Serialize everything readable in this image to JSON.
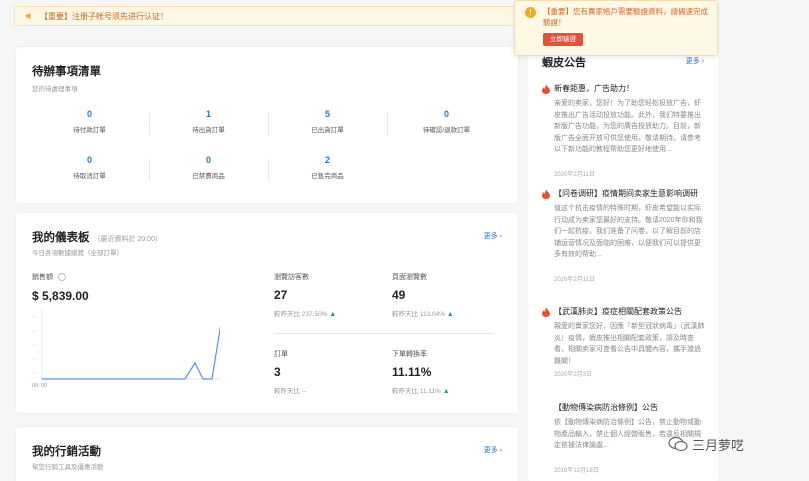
{
  "notice": {
    "text": "【重要】注册子帐号须先进行认证！"
  },
  "todo": {
    "title": "待辦事項清單",
    "subtitle": "您的待處理事項",
    "items": [
      {
        "value": "0",
        "label": "待付款訂單"
      },
      {
        "value": "1",
        "label": "待出貨訂單"
      },
      {
        "value": "5",
        "label": "已出貨訂單"
      },
      {
        "value": "0",
        "label": "待確認/退款訂單"
      },
      {
        "value": "0",
        "label": "待取消訂單"
      },
      {
        "value": "0",
        "label": "已禁賣商品"
      },
      {
        "value": "2",
        "label": "已售完商品"
      }
    ]
  },
  "dashboard": {
    "title": "我的儀表板",
    "note": "（最近資料於 20:00）",
    "subtitle": "今日各項數據總覽（全部訂單）",
    "more": "更多",
    "sales_label": "銷售額",
    "sales_value": "$ 5,839.00",
    "axis_label": "00: 00",
    "kpis": [
      {
        "label": "瀏覽訪客數",
        "value": "27",
        "compare": "較昨天比 237.50%"
      },
      {
        "label": "頁面瀏覽數",
        "value": "49",
        "compare": "較昨天比 113.04%"
      },
      {
        "label": "訂單",
        "value": "3",
        "compare": "較昨天比 --"
      },
      {
        "label": "下單轉換率",
        "value": "11.11%",
        "compare": "較昨天比 11.11%"
      }
    ]
  },
  "marketing": {
    "title": "我的行銷活動",
    "subtitle": "幫您行銷工具及優惠活動",
    "more": "更多"
  },
  "announcements": {
    "title": "蝦皮公告",
    "more": "更多",
    "items": [
      {
        "title": "新春鉅惠，广告助力！",
        "body": "亲爱的卖家，您好！为了助您轻松投放广告，虾皮推出广告活动投放功能。此外，我们特要推出新版广告功能，为您的廣告投放助力。目前，新版广告全面开放可供您使用，敬请期待。请参考以下新功能的教程帮助您更好地使用...",
        "date": "2020年2月11日"
      },
      {
        "title": "【问卷调研】疫情期间卖家生意影响调研",
        "body": "值这个抗击疫情的特殊时期，虾皮希望能以实际行动成为卖家您最好的支持。敬请2020年你和我们一起抗疫。我们准备了问卷，以了解目前的店铺运营情况及面临的困难，以便我们可以提供更多有效的帮助...",
        "date": "2020年2月11日"
      },
      {
        "title": "【武漢肺炎】疫症相關配套政策公告",
        "body": "親愛的賣家您好，因應「新型冠狀病毒」（武漢肺炎）疫情，蝦皮推出相關配套政策，請及時查看，相關卖家可查看公告中具體內容，攜手渡過難關！",
        "date": "2020年2月3日"
      },
      {
        "title": "【動物傳染病防治條例】公告",
        "body": "依【動物傳染病防治條例】公告，禁止動物或動物產品輸入，禁止個人經營販售，若違反相關規定依據法律論處...",
        "date": "2019年12月18日"
      }
    ]
  },
  "toast": {
    "text": "【重要】您有賣家帳戶需要驗證資料，請儘速完成驗證！",
    "button": "立即驗證"
  },
  "watermark": {
    "text": "三月萝呓"
  }
}
